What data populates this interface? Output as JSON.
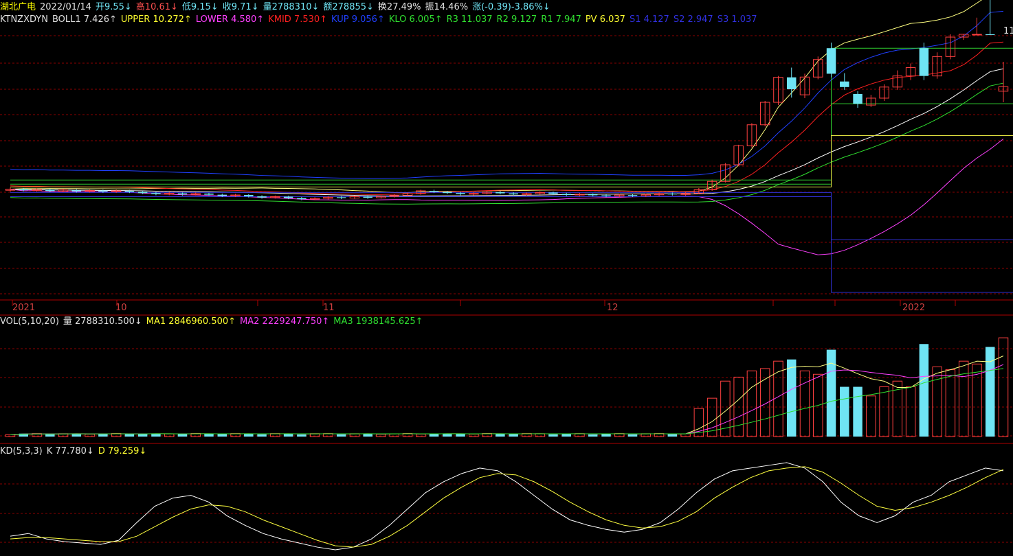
{
  "quote_bar": {
    "name": "湖北广电",
    "date": "2022/01/14",
    "open": "开9.55↓",
    "high": "高10.61↓",
    "low": "低9.15↓",
    "close": "收9.71↓",
    "volume": "量2788310↓",
    "amount": "额278855↓",
    "turnover": "换27.49%",
    "amplitude": "振14.46%",
    "change": "涨(-0.39)-3.86%↓"
  },
  "indicator_bar": {
    "name": "KTNZXDYN",
    "boll": "BOLL1 7.426↑",
    "upper": "UPPER 10.272↑",
    "lower": "LOWER 4.580↑",
    "kmid": "KMID 7.530↑",
    "kup": "KUP 9.056↑",
    "klo": "KLO 6.005↑",
    "r3": "R3 11.037",
    "r2": "R2 9.127",
    "r1": "R1 7.947",
    "pv": "PV 6.037",
    "s1": "S1 4.127",
    "s2": "S2 2.947",
    "s3": "S3 1.037"
  },
  "price_max_label": "11",
  "date_axis": {
    "labels": [
      "2021",
      "10",
      "11",
      "12",
      "2022"
    ]
  },
  "volume_bar": {
    "name": "VOL(5,10,20)",
    "vol": "量 2788310.500↓",
    "ma1": "MA1 2846960.500↑",
    "ma2": "MA2 2229247.750↑",
    "ma3": "MA3 1938145.625↑"
  },
  "kd_bar": {
    "name": "KD(5,3,3)",
    "k": "K 77.780↓",
    "d": "D 79.259↓"
  },
  "colors": {
    "background": "#000000",
    "grid": "#8b0000",
    "up": "#ff4040",
    "down": "#6fe4f4",
    "boll_upper": "#ffff80",
    "boll_lower": "#ff40ff",
    "kmid": "#ff2020",
    "kup": "#2040ff",
    "klo": "#30e030",
    "pivot_green": "#30d030",
    "pv_yellow": "#e0e040",
    "s_blue": "#3030d0",
    "k_line": "#ffffff",
    "d_line": "#ffff40"
  },
  "chart_data": {
    "type": "candlestick",
    "ylim_price": [
      2.2,
      11.6
    ],
    "candles": [
      {
        "o": 5.98,
        "c": 6.02,
        "h": 6.08,
        "l": 5.93
      },
      {
        "o": 6.02,
        "c": 5.98,
        "h": 6.06,
        "l": 5.94
      },
      {
        "o": 5.97,
        "c": 6.01,
        "h": 6.05,
        "l": 5.93
      },
      {
        "o": 6.0,
        "c": 5.95,
        "h": 6.04,
        "l": 5.91
      },
      {
        "o": 5.95,
        "c": 5.99,
        "h": 6.03,
        "l": 5.92
      },
      {
        "o": 5.98,
        "c": 5.94,
        "h": 6.02,
        "l": 5.9
      },
      {
        "o": 5.94,
        "c": 5.97,
        "h": 6.01,
        "l": 5.9
      },
      {
        "o": 5.97,
        "c": 5.93,
        "h": 6.0,
        "l": 5.89
      },
      {
        "o": 5.93,
        "c": 5.96,
        "h": 6.0,
        "l": 5.89
      },
      {
        "o": 5.96,
        "c": 5.92,
        "h": 5.99,
        "l": 5.88
      },
      {
        "o": 5.92,
        "c": 5.88,
        "h": 5.96,
        "l": 5.84
      },
      {
        "o": 5.88,
        "c": 5.84,
        "h": 5.92,
        "l": 5.8
      },
      {
        "o": 5.84,
        "c": 5.87,
        "h": 5.91,
        "l": 5.8
      },
      {
        "o": 5.87,
        "c": 5.83,
        "h": 5.9,
        "l": 5.79
      },
      {
        "o": 5.83,
        "c": 5.86,
        "h": 5.9,
        "l": 5.79
      },
      {
        "o": 5.86,
        "c": 5.82,
        "h": 5.89,
        "l": 5.78
      },
      {
        "o": 5.82,
        "c": 5.78,
        "h": 5.86,
        "l": 5.74
      },
      {
        "o": 5.78,
        "c": 5.81,
        "h": 5.85,
        "l": 5.74
      },
      {
        "o": 5.81,
        "c": 5.76,
        "h": 5.84,
        "l": 5.72
      },
      {
        "o": 5.76,
        "c": 5.72,
        "h": 5.8,
        "l": 5.68
      },
      {
        "o": 5.72,
        "c": 5.75,
        "h": 5.79,
        "l": 5.68
      },
      {
        "o": 5.75,
        "c": 5.7,
        "h": 5.78,
        "l": 5.66
      },
      {
        "o": 5.7,
        "c": 5.66,
        "h": 5.74,
        "l": 5.62
      },
      {
        "o": 5.66,
        "c": 5.69,
        "h": 5.73,
        "l": 5.62
      },
      {
        "o": 5.69,
        "c": 5.73,
        "h": 5.77,
        "l": 5.65
      },
      {
        "o": 5.73,
        "c": 5.7,
        "h": 5.77,
        "l": 5.66
      },
      {
        "o": 5.7,
        "c": 5.75,
        "h": 5.79,
        "l": 5.67
      },
      {
        "o": 5.75,
        "c": 5.71,
        "h": 5.78,
        "l": 5.67
      },
      {
        "o": 5.71,
        "c": 5.76,
        "h": 5.8,
        "l": 5.68
      },
      {
        "o": 5.76,
        "c": 5.8,
        "h": 5.84,
        "l": 5.72
      },
      {
        "o": 5.8,
        "c": 5.86,
        "h": 5.9,
        "l": 5.77
      },
      {
        "o": 5.86,
        "c": 5.96,
        "h": 6.0,
        "l": 5.82
      },
      {
        "o": 5.96,
        "c": 5.92,
        "h": 6.0,
        "l": 5.88
      },
      {
        "o": 5.92,
        "c": 5.88,
        "h": 5.96,
        "l": 5.84
      },
      {
        "o": 5.88,
        "c": 5.84,
        "h": 5.92,
        "l": 5.8
      },
      {
        "o": 5.84,
        "c": 5.87,
        "h": 5.91,
        "l": 5.8
      },
      {
        "o": 5.87,
        "c": 5.91,
        "h": 5.95,
        "l": 5.83
      },
      {
        "o": 5.91,
        "c": 5.87,
        "h": 5.95,
        "l": 5.83
      },
      {
        "o": 5.87,
        "c": 5.83,
        "h": 5.91,
        "l": 5.79
      },
      {
        "o": 5.83,
        "c": 5.86,
        "h": 5.9,
        "l": 5.79
      },
      {
        "o": 5.86,
        "c": 5.9,
        "h": 5.94,
        "l": 5.82
      },
      {
        "o": 5.9,
        "c": 5.85,
        "h": 5.93,
        "l": 5.81
      },
      {
        "o": 5.85,
        "c": 5.81,
        "h": 5.89,
        "l": 5.77
      },
      {
        "o": 5.81,
        "c": 5.84,
        "h": 5.88,
        "l": 5.77
      },
      {
        "o": 5.84,
        "c": 5.8,
        "h": 5.87,
        "l": 5.76
      },
      {
        "o": 5.8,
        "c": 5.77,
        "h": 5.84,
        "l": 5.73
      },
      {
        "o": 5.77,
        "c": 5.81,
        "h": 5.85,
        "l": 5.73
      },
      {
        "o": 5.81,
        "c": 5.78,
        "h": 5.85,
        "l": 5.74
      },
      {
        "o": 5.78,
        "c": 5.82,
        "h": 5.86,
        "l": 5.74
      },
      {
        "o": 5.82,
        "c": 5.86,
        "h": 5.9,
        "l": 5.78
      },
      {
        "o": 5.86,
        "c": 5.83,
        "h": 5.9,
        "l": 5.79
      },
      {
        "o": 5.83,
        "c": 5.87,
        "h": 5.91,
        "l": 5.79
      },
      {
        "o": 5.87,
        "c": 6.0,
        "h": 6.06,
        "l": 5.84
      },
      {
        "o": 6.0,
        "c": 6.3,
        "h": 6.36,
        "l": 5.96
      },
      {
        "o": 6.3,
        "c": 6.9,
        "h": 6.96,
        "l": 6.26
      },
      {
        "o": 6.9,
        "c": 7.58,
        "h": 7.62,
        "l": 6.85
      },
      {
        "o": 7.58,
        "c": 8.34,
        "h": 8.4,
        "l": 7.52
      },
      {
        "o": 8.34,
        "c": 9.15,
        "h": 9.2,
        "l": 8.28
      },
      {
        "o": 9.15,
        "c": 10.05,
        "h": 10.1,
        "l": 9.05
      },
      {
        "o": 10.05,
        "c": 9.62,
        "h": 10.4,
        "l": 9.32
      },
      {
        "o": 9.42,
        "c": 10.06,
        "h": 10.18,
        "l": 9.3
      },
      {
        "o": 10.06,
        "c": 10.69,
        "h": 10.8,
        "l": 9.98
      },
      {
        "o": 11.1,
        "c": 10.18,
        "h": 11.3,
        "l": 10.05
      },
      {
        "o": 9.9,
        "c": 9.7,
        "h": 10.2,
        "l": 9.6
      },
      {
        "o": 9.45,
        "c": 9.1,
        "h": 9.55,
        "l": 8.95
      },
      {
        "o": 9.05,
        "c": 9.3,
        "h": 9.42,
        "l": 8.98
      },
      {
        "o": 9.3,
        "c": 9.7,
        "h": 9.8,
        "l": 9.2
      },
      {
        "o": 9.7,
        "c": 10.1,
        "h": 10.3,
        "l": 9.6
      },
      {
        "o": 10.1,
        "c": 10.4,
        "h": 10.55,
        "l": 9.95
      },
      {
        "o": 11.1,
        "c": 10.1,
        "h": 11.3,
        "l": 9.95
      },
      {
        "o": 10.1,
        "c": 10.8,
        "h": 10.95,
        "l": 10.0
      },
      {
        "o": 10.8,
        "c": 11.5,
        "h": 11.6,
        "l": 10.7
      },
      {
        "o": 11.5,
        "c": 12.3,
        "h": 12.45,
        "l": 11.4
      },
      {
        "o": 12.3,
        "c": 13.1,
        "h": 13.2,
        "l": 12.2
      },
      {
        "o": 14.2,
        "c": 13.3,
        "h": 14.3,
        "l": 13.0
      },
      {
        "o": 9.55,
        "c": 9.71,
        "h": 10.61,
        "l": 9.15
      }
    ],
    "k_values": [
      30,
      32,
      28,
      26,
      25,
      24,
      27,
      40,
      52,
      58,
      60,
      55,
      45,
      38,
      32,
      28,
      25,
      22,
      20,
      22,
      28,
      38,
      50,
      62,
      70,
      76,
      80,
      78,
      70,
      60,
      50,
      42,
      38,
      35,
      33,
      35,
      40,
      50,
      62,
      72,
      78,
      80,
      82,
      84,
      80,
      70,
      55,
      45,
      40,
      45,
      55,
      60,
      70,
      75,
      80,
      78
    ],
    "d_values": [
      28,
      29,
      29,
      28,
      27,
      26,
      26,
      30,
      37,
      44,
      50,
      53,
      52,
      48,
      42,
      37,
      32,
      27,
      23,
      22,
      24,
      30,
      38,
      48,
      58,
      66,
      73,
      76,
      75,
      70,
      63,
      55,
      48,
      42,
      38,
      36,
      37,
      41,
      48,
      58,
      66,
      73,
      78,
      80,
      81,
      77,
      69,
      60,
      52,
      49,
      51,
      55,
      60,
      66,
      73,
      79
    ]
  }
}
